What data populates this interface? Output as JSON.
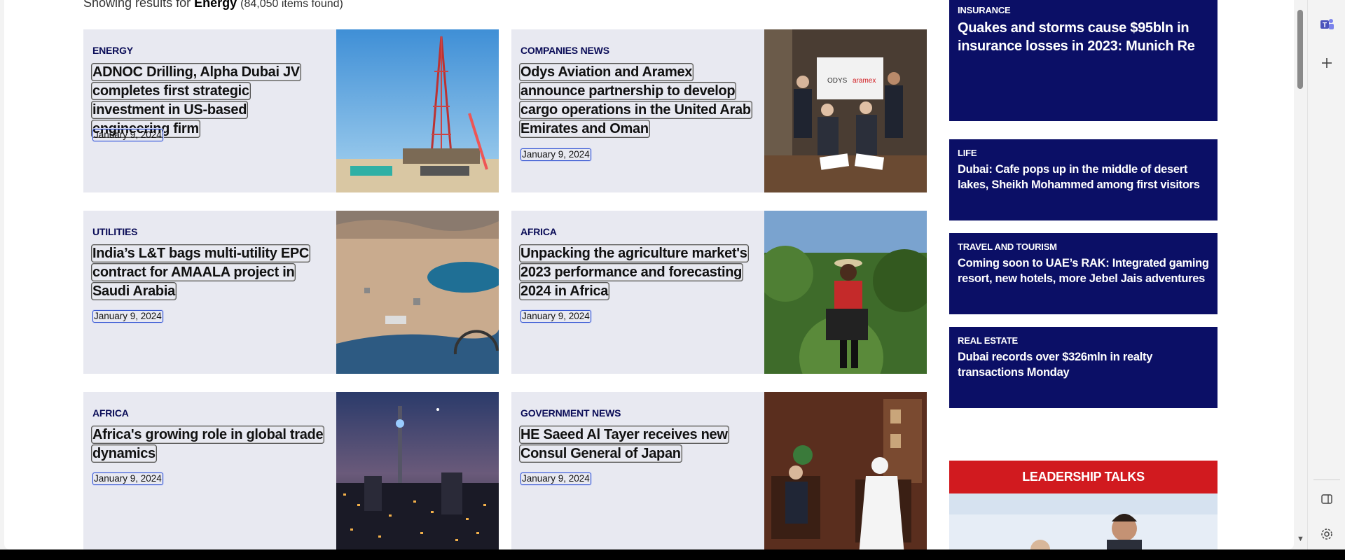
{
  "results": {
    "prefix": "Showing results for ",
    "term": "Energy",
    "count": "(84,050 items found)"
  },
  "cards": [
    {
      "category": "ENERGY",
      "title": "ADNOC Drilling, Alpha Dubai JV completes first strategic investment in US-based engineering firm",
      "date": "January 9, 2024",
      "image_icon": "oil-rig-image"
    },
    {
      "category": "COMPANIES NEWS",
      "title": "Odys Aviation and Aramex announce partnership to develop cargo operations in the United Arab Emirates and Oman",
      "date": "January 9, 2024",
      "image_icon": "signing-ceremony-image",
      "image_caption_left": "ODYS",
      "image_caption_right": "aramex"
    },
    {
      "category": "UTILITIES",
      "title": "India’s L&T bags multi-utility EPC contract for AMAALA project in Saudi Arabia",
      "date": "January 9, 2024",
      "image_icon": "coastal-construction-image"
    },
    {
      "category": "AFRICA",
      "title": "Unpacking the agriculture market's 2023 performance and forecasting 2024 in Africa",
      "date": "January 9, 2024",
      "image_icon": "farmer-vineyard-image"
    },
    {
      "category": "AFRICA",
      "title": "Africa's growing role in global trade dynamics",
      "date": "January 9, 2024",
      "image_icon": "city-night-image"
    },
    {
      "category": "GOVERNMENT NEWS",
      "title": "HE Saeed Al Tayer receives new Consul General of Japan",
      "date": "January 9, 2024",
      "image_icon": "official-meeting-image"
    }
  ],
  "sidebar": [
    {
      "category": "INSURANCE",
      "title": "Quakes and storms cause $95bln in insurance losses in 2023: Munich Re"
    },
    {
      "category": "LIFE",
      "title": "Dubai: Cafe pops up in the middle of desert lakes, Sheikh Mohammed among first visitors"
    },
    {
      "category": "TRAVEL AND TOURISM",
      "title": "Coming soon to UAE’s RAK: Integrated gaming resort, new hotels, more Jebel Jais adventures"
    },
    {
      "category": "REAL ESTATE",
      "title": "Dubai records over $326mln in realty transactions Monday"
    }
  ],
  "leadership": {
    "label": "LEADERSHIP TALKS"
  },
  "edge_bar": {
    "icons": [
      "teams-icon",
      "add-icon",
      "split-screen-icon",
      "settings-icon"
    ]
  },
  "colors": {
    "navy": "#0b0f66",
    "red": "#d11a1f",
    "card_bg": "#e8e9f1",
    "date_outline": "#2d4fd0"
  }
}
